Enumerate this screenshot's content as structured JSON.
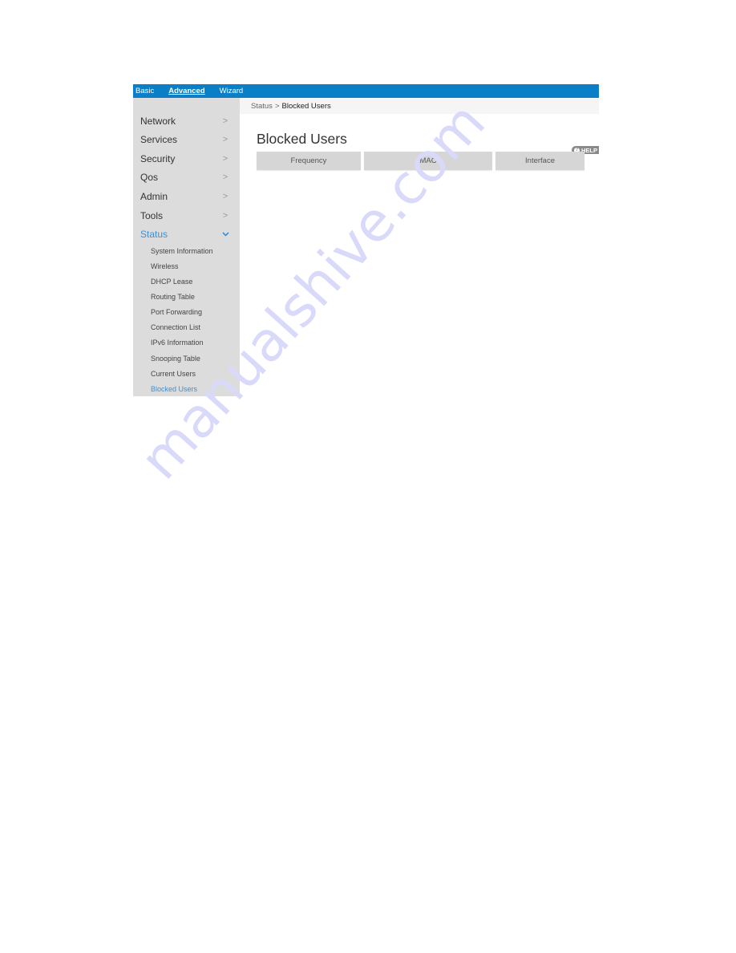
{
  "topbar": {
    "tabs": [
      {
        "label": "Basic",
        "active": false
      },
      {
        "label": "Advanced",
        "active": true
      },
      {
        "label": "Wizard",
        "active": false
      }
    ]
  },
  "sidebar": {
    "items": [
      {
        "label": "Network",
        "icon": "chevron-right-icon",
        "active": false
      },
      {
        "label": "Services",
        "icon": "chevron-right-icon",
        "active": false
      },
      {
        "label": "Security",
        "icon": "chevron-right-icon",
        "active": false
      },
      {
        "label": "Qos",
        "icon": "chevron-right-icon",
        "active": false
      },
      {
        "label": "Admin",
        "icon": "chevron-right-icon",
        "active": false
      },
      {
        "label": "Tools",
        "icon": "chevron-right-icon",
        "active": false
      },
      {
        "label": "Status",
        "icon": "chevron-down-icon",
        "active": true
      }
    ],
    "status_subitems": [
      {
        "label": "System Information",
        "active": false
      },
      {
        "label": "Wireless",
        "active": false
      },
      {
        "label": "DHCP Lease",
        "active": false
      },
      {
        "label": "Routing Table",
        "active": false
      },
      {
        "label": "Port Forwarding",
        "active": false
      },
      {
        "label": "Connection List",
        "active": false
      },
      {
        "label": "IPv6 Information",
        "active": false
      },
      {
        "label": "Snooping Table",
        "active": false
      },
      {
        "label": "Current Users",
        "active": false
      },
      {
        "label": "Blocked Users",
        "active": true
      }
    ],
    "chevron_right_glyph": ">",
    "chevron_down_glyph": "⌄"
  },
  "breadcrumb": {
    "parent": "Status",
    "separator": ">",
    "current": "Blocked Users"
  },
  "main": {
    "title": "Blocked Users",
    "help_label": "HELP",
    "help_icon_glyph": "?",
    "table": {
      "columns": [
        "Frequency",
        "MAC",
        "Interface"
      ],
      "rows": []
    }
  },
  "watermark": "manualshive.com",
  "colors": {
    "topbar": "#0a7fc7",
    "accent": "#3a90d6",
    "sidebar_bg": "#dcdcdc",
    "header_cell_bg": "#d6d6d6"
  }
}
